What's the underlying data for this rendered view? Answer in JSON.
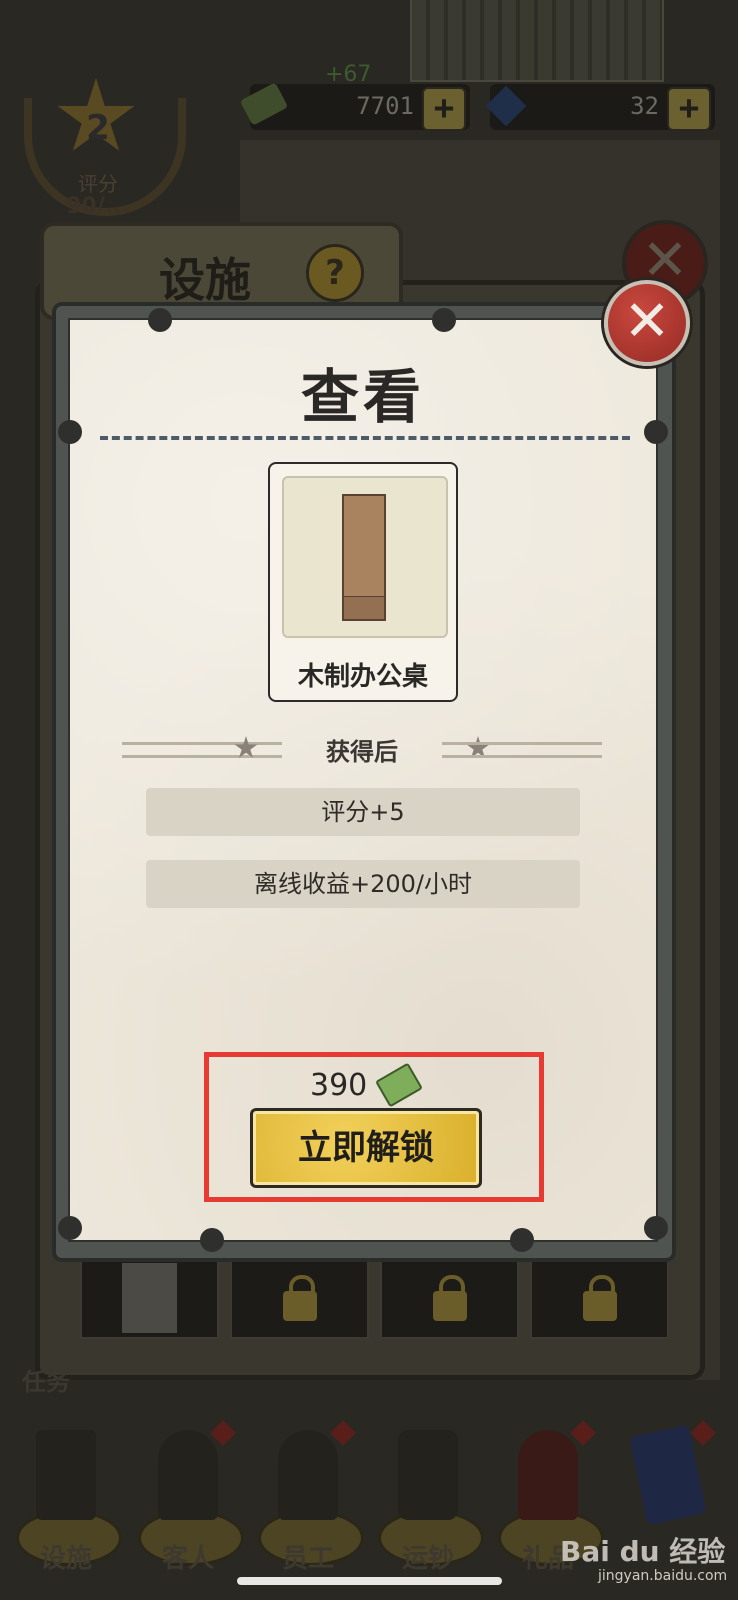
{
  "background": {
    "resources": {
      "money_gain": "+67",
      "money": "7701",
      "gems": "32",
      "plus": "+"
    },
    "rank": {
      "level": "2",
      "label": "评分",
      "score": "90/..."
    },
    "panel_title": "设施",
    "help_glyph": "?",
    "close_glyph": "✕",
    "task_label": "任务",
    "nav": [
      {
        "label": "设施"
      },
      {
        "label": "客人"
      },
      {
        "label": "员工"
      },
      {
        "label": "运钞"
      },
      {
        "label": "礼品"
      }
    ],
    "watermark": "Bai du 经验",
    "watermark_sub": "jingyan.baidu.com"
  },
  "dialog": {
    "title": "查看",
    "item": {
      "name": "木制办公桌",
      "icon": "wooden-desk-icon"
    },
    "section_label": "获得后",
    "benefits": [
      "评分+5",
      "离线收益+200/小时"
    ],
    "price": "390",
    "price_icon": "money-icon",
    "unlock_label": "立即解锁",
    "close_glyph": "✕"
  },
  "colors": {
    "button_gold": "#e8c23c",
    "close_red": "#c9483e",
    "highlight_red": "#e63a32",
    "card_bg": "#eee8dc"
  }
}
